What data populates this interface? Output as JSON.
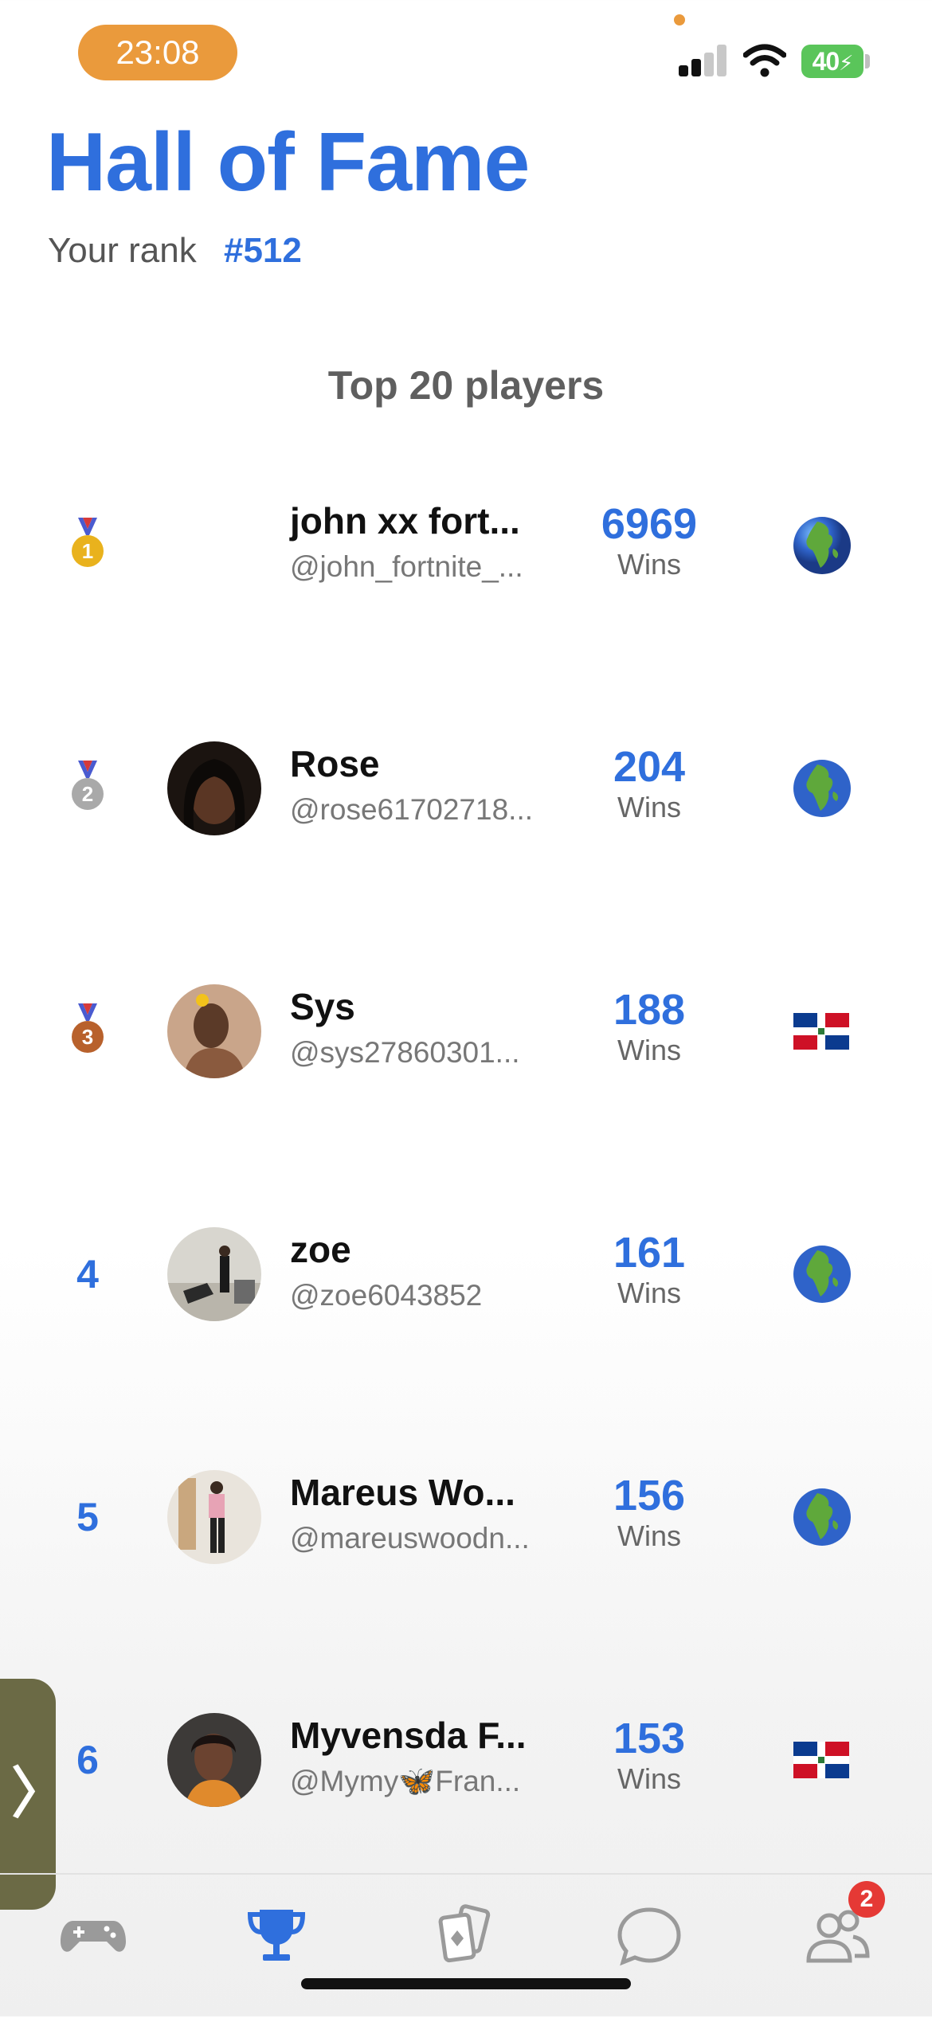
{
  "status_bar": {
    "time": "23:08",
    "battery": "40"
  },
  "header": {
    "title": "Hall of Fame",
    "rank_label": "Your rank",
    "rank_value": "#512"
  },
  "list": {
    "title": "Top 20 players",
    "players": [
      {
        "rank": "1",
        "medal": "gold",
        "name": "john xx fort...",
        "handle": "@john_fortnite_...",
        "wins": "6969",
        "wins_label": "Wins",
        "region": "globe-icon"
      },
      {
        "rank": "2",
        "medal": "silver",
        "name": "Rose",
        "handle": "@rose61702718...",
        "wins": "204",
        "wins_label": "Wins",
        "region": "globe-icon"
      },
      {
        "rank": "3",
        "medal": "bronze",
        "name": "Sys",
        "handle": "@sys27860301...",
        "wins": "188",
        "wins_label": "Wins",
        "region": "flag-dominican-republic"
      },
      {
        "rank": "4",
        "medal": "",
        "name": "zoe",
        "handle": "@zoe6043852",
        "wins": "161",
        "wins_label": "Wins",
        "region": "globe-icon"
      },
      {
        "rank": "5",
        "medal": "",
        "name": "Mareus Wo...",
        "handle": "@mareuswoodn...",
        "wins": "156",
        "wins_label": "Wins",
        "region": "globe-icon"
      },
      {
        "rank": "6",
        "medal": "",
        "name": "Myvensda F...",
        "handle": "@Mymy🦋Fran...",
        "wins": "153",
        "wins_label": "Wins",
        "region": "flag-dominican-republic"
      }
    ]
  },
  "tabbar": {
    "tabs": [
      "gamepad-icon",
      "trophy-icon",
      "cards-icon",
      "chat-icon",
      "friends-icon"
    ],
    "active": "trophy-icon",
    "friends_badge": "2"
  },
  "colors": {
    "accent": "#2f6fdd",
    "time_pill": "#ea9a3c",
    "badge": "#e53935"
  }
}
